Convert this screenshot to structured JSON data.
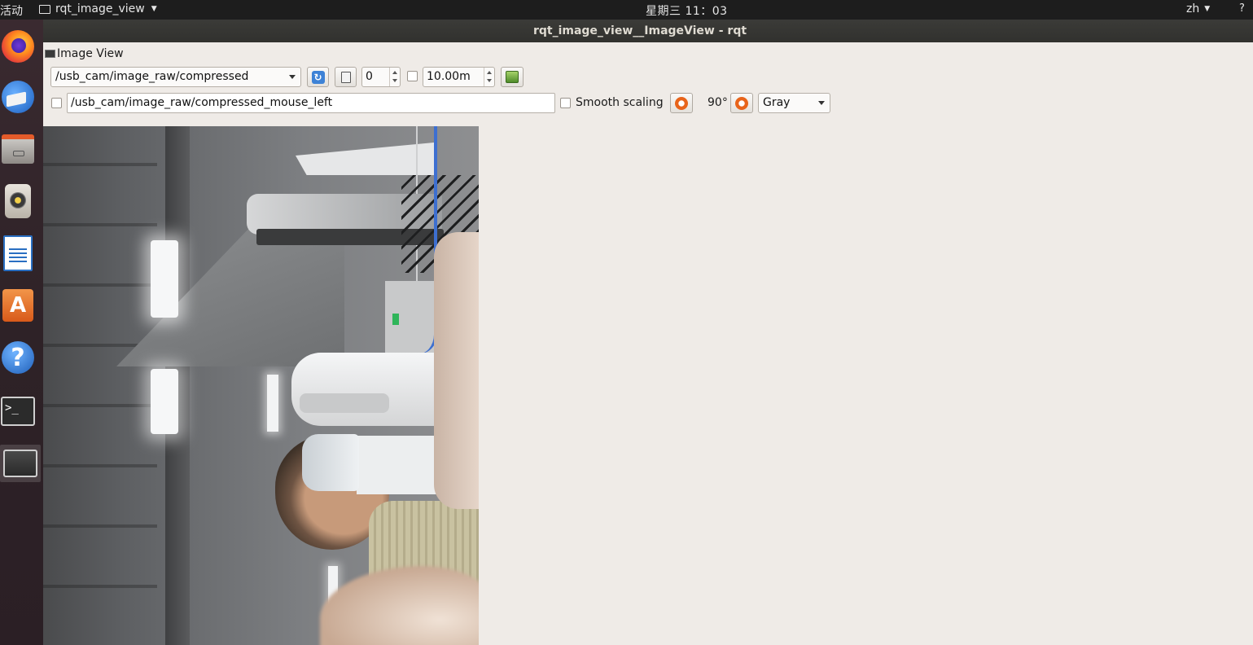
{
  "topbar": {
    "activities": "活动",
    "app_menu": "rqt_image_view",
    "clock": "星期三 11：03",
    "input_lang": "zh",
    "system_menu": "?"
  },
  "dock": {
    "items": [
      {
        "name": "firefox",
        "icon": "firefox-icon"
      },
      {
        "name": "thunderbird",
        "icon": "mail-icon"
      },
      {
        "name": "files",
        "icon": "files-icon"
      },
      {
        "name": "rhythmbox",
        "icon": "speaker-icon"
      },
      {
        "name": "libreoffice-writer",
        "icon": "document-icon"
      },
      {
        "name": "ubuntu-software",
        "icon": "store-icon",
        "glyph": "A"
      },
      {
        "name": "help",
        "icon": "help-icon",
        "glyph": "?"
      },
      {
        "name": "terminal",
        "icon": "terminal-icon",
        "glyph": ">_"
      },
      {
        "name": "rqt",
        "icon": "window-icon",
        "active": true
      }
    ]
  },
  "window": {
    "title": "rqt_image_view__ImageView - rqt"
  },
  "plugin": {
    "title": "Image View",
    "topic_combo": "/usb_cam/image_raw/compressed",
    "refresh_icon": "refresh-icon",
    "zoom_icon": "fit-zoom-icon",
    "zoom_value": "0",
    "max_range_checked": false,
    "max_range_value": "10.00m",
    "save_icon": "save-image-icon",
    "mouse_pub_checked": false,
    "mouse_topic": "/usb_cam/image_raw/compressed_mouse_left",
    "smooth_scaling_checked": false,
    "smooth_scaling_label": "Smooth scaling",
    "rotate_left_icon": "rotate-left-icon",
    "rotation_label": "90°",
    "rotate_right_icon": "rotate-right-icon",
    "color_scheme": "Gray"
  },
  "colors": {
    "topbar_bg": "#1d1d1d",
    "dock_bg": "#2e2227",
    "titlebar_bg": "#33332f",
    "window_bg": "#efebe7",
    "accent_orange": "#e8641b",
    "accent_blue": "#3d82d6"
  }
}
